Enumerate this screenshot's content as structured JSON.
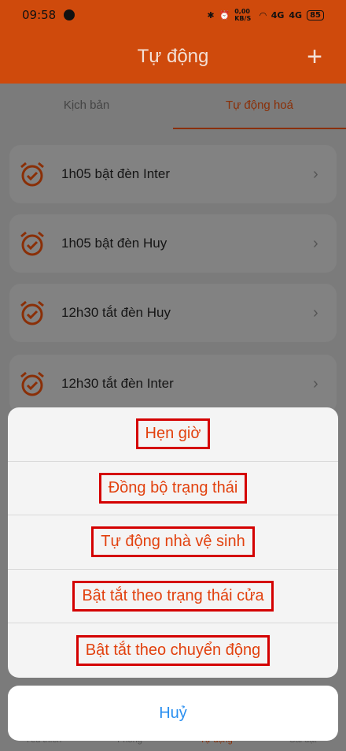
{
  "status": {
    "time": "09:58",
    "net_speed": "0,00 KB/S",
    "battery": "85",
    "signal1": "4G",
    "signal2": "4G"
  },
  "header": {
    "title": "Tự động",
    "add_icon": "plus-icon"
  },
  "tabs": [
    {
      "label": "Kịch bản"
    },
    {
      "label": "Tự động hoá"
    }
  ],
  "automations": [
    {
      "label": "1h05 bật đèn Inter"
    },
    {
      "label": "1h05 bật đèn Huy"
    },
    {
      "label": "12h30 tắt đèn Huy"
    },
    {
      "label": "12h30 tắt đèn Inter"
    }
  ],
  "bottom_nav": [
    {
      "label": "Yêu thích"
    },
    {
      "label": "Phòng"
    },
    {
      "label": "Tự động"
    },
    {
      "label": "Cài đặt"
    }
  ],
  "sheet": {
    "options": [
      {
        "label": "Hẹn giờ"
      },
      {
        "label": "Đồng bộ trạng thái"
      },
      {
        "label": "Tự động nhà vệ sinh"
      },
      {
        "label": "Bật tắt theo trạng thái cửa"
      },
      {
        "label": "Bật tắt theo chuyển động"
      }
    ],
    "cancel_label": "Huỷ"
  },
  "colors": {
    "brand": "#cf4a0c",
    "option_text": "#e2410e",
    "cancel_text": "#2a8ff0"
  }
}
